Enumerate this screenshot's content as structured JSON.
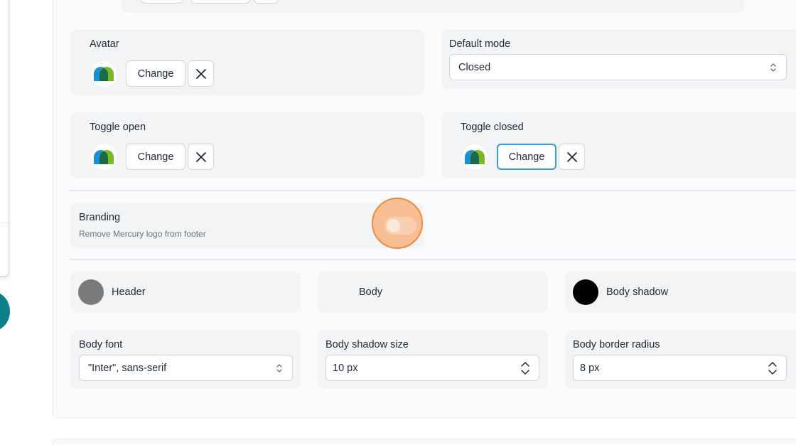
{
  "widget": {
    "avatar": {
      "label": "Avatar",
      "change_label": "Change"
    },
    "default_mode": {
      "label": "Default mode",
      "value": "Closed"
    },
    "toggle_open": {
      "label": "Toggle open",
      "change_label": "Change"
    },
    "toggle_closed": {
      "label": "Toggle closed",
      "change_label": "Change"
    },
    "branding": {
      "label": "Branding",
      "description": "Remove Mercury logo from footer",
      "enabled": false
    },
    "colors": {
      "header": {
        "label": "Header",
        "color": "#7a7a7a"
      },
      "body": {
        "label": "Body",
        "color": "#f5f5f5"
      },
      "body_shadow": {
        "label": "Body shadow",
        "color": "#000000"
      }
    },
    "body_font": {
      "label": "Body font",
      "value": "\"Inter\", sans-serif"
    },
    "body_shadow_size": {
      "label": "Body shadow size",
      "value": "10 px"
    },
    "body_border_radius": {
      "label": "Body border radius",
      "value": "8 px"
    }
  },
  "icons": {
    "close": "close-icon",
    "select": "chevron-updown-icon",
    "avatar": "mercury-logo-icon"
  },
  "accent_colors": {
    "focus": "#3b9ad9",
    "highlight": "#f08a3c",
    "logo_blue": "#1a8fd1",
    "logo_green": "#7ab829"
  }
}
